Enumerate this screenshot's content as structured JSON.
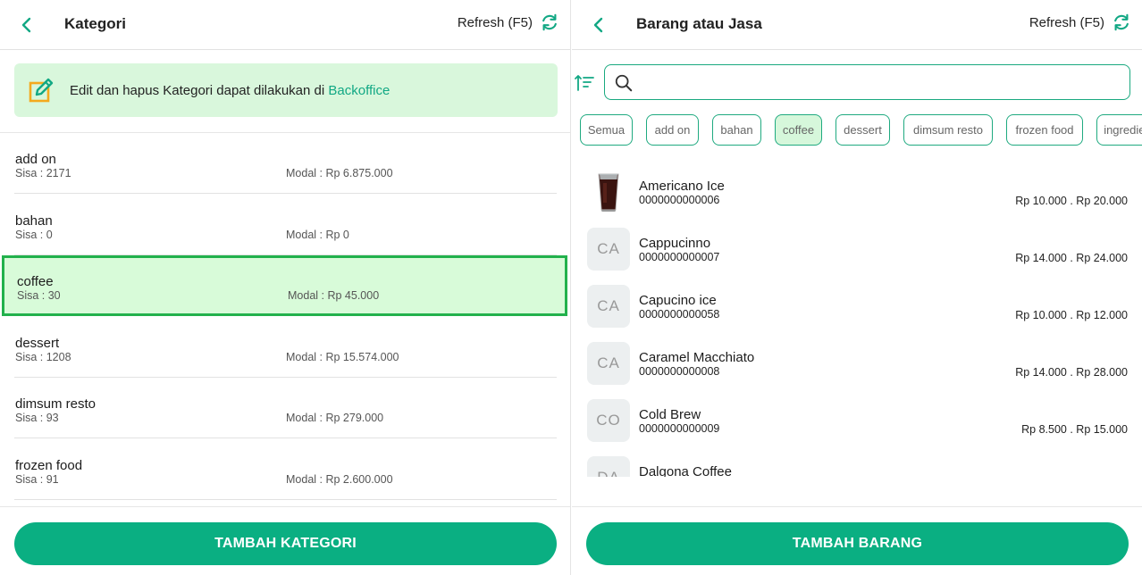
{
  "left": {
    "title": "Kategori",
    "refresh_label": "Refresh (F5)",
    "banner_text": "Edit dan hapus Kategori dapat dilakukan di ",
    "banner_link": "Backoffice",
    "categories": [
      {
        "name": "add on",
        "sisa": "Sisa : 2171",
        "modal": "Modal : Rp 6.875.000"
      },
      {
        "name": "bahan",
        "sisa": "Sisa : 0",
        "modal": "Modal : Rp 0"
      },
      {
        "name": "coffee",
        "sisa": "Sisa : 30",
        "modal": "Modal : Rp 45.000",
        "selected": true
      },
      {
        "name": "dessert",
        "sisa": "Sisa : 1208",
        "modal": "Modal : Rp 15.574.000"
      },
      {
        "name": "dimsum resto",
        "sisa": "Sisa : 93",
        "modal": "Modal : Rp 279.000"
      },
      {
        "name": "frozen food",
        "sisa": "Sisa : 91",
        "modal": "Modal : Rp 2.600.000"
      }
    ],
    "add_button": "TAMBAH KATEGORI"
  },
  "right": {
    "title": "Barang atau Jasa",
    "refresh_label": "Refresh (F5)",
    "search_placeholder": "",
    "search_value": "",
    "chips": [
      {
        "label": "Semua"
      },
      {
        "label": "add on"
      },
      {
        "label": "bahan"
      },
      {
        "label": "coffee",
        "active": true
      },
      {
        "label": "dessert"
      },
      {
        "label": "dimsum resto"
      },
      {
        "label": "frozen food"
      },
      {
        "label": "ingredients"
      }
    ],
    "products": [
      {
        "initials": "",
        "image": "iced-coffee-glass",
        "name": "Americano Ice",
        "code": "0000000000006",
        "price": "Rp 10.000 . Rp 20.000"
      },
      {
        "initials": "CA",
        "name": "Cappucinno",
        "code": "0000000000007",
        "price": "Rp 14.000 . Rp 24.000"
      },
      {
        "initials": "CA",
        "name": "Capucino ice",
        "code": "0000000000058",
        "price": "Rp 10.000 . Rp 12.000"
      },
      {
        "initials": "CA",
        "name": "Caramel Macchiato",
        "code": "0000000000008",
        "price": "Rp 14.000 . Rp 28.000"
      },
      {
        "initials": "CO",
        "name": "Cold Brew",
        "code": "0000000000009",
        "price": "Rp 8.500 . Rp 15.000"
      },
      {
        "initials": "DA",
        "name": "Dalgona Coffee",
        "code": "",
        "price": ""
      }
    ],
    "add_button": "TAMBAH BARANG"
  },
  "colors": {
    "accent": "#0aaf82",
    "banner_bg": "#d9f7dc",
    "selected_border": "#22b14c"
  }
}
